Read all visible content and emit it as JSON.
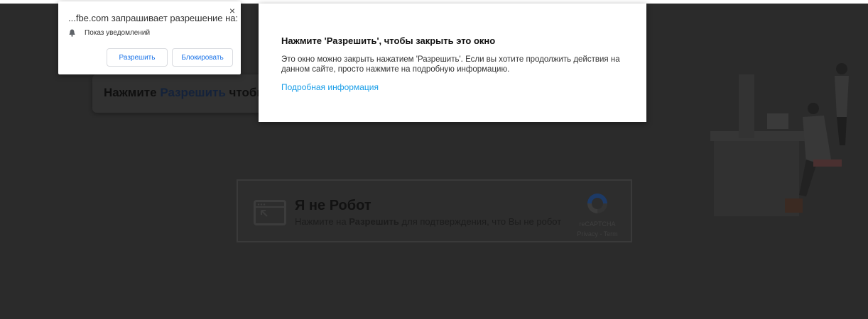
{
  "permission_prompt": {
    "title": "...fbe.com запрашивает разрешение на:",
    "permission": "Показ уведомлений",
    "allow_label": "Разрешить",
    "block_label": "Блокировать",
    "close": "×"
  },
  "background_card": {
    "prefix": "Нажмите ",
    "highlight": "Разрешить",
    "suffix": " чтобы"
  },
  "dialog": {
    "title": "Нажмите 'Разрешить', чтобы закрыть это окно",
    "body": "Это окно можно закрыть нажатием 'Разрешить'. Если вы хотите продолжить действия на данном сайте, просто нажмите на подробную информацию.",
    "link": "Подробная информация",
    "link_color": "#1a9ee8"
  },
  "captcha": {
    "title": "Я не Робот",
    "sub_prefix": "Нажмите на ",
    "sub_bold": "Разрешить",
    "sub_suffix": " для подтверждения, что Вы не робот",
    "brand": "reCAPTCHA",
    "links": "Privacy - Term"
  }
}
